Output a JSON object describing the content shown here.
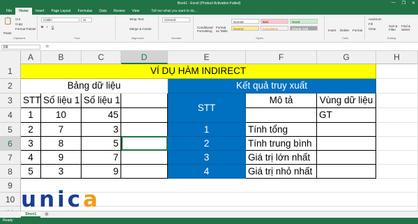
{
  "window": {
    "title": "Book1 - Excel (Product Activation Failed)",
    "controls": [
      "—",
      "❐",
      "✕"
    ]
  },
  "ribbon_tabs": [
    "File",
    "Home",
    "Insert",
    "Page Layout",
    "Formulas",
    "Data",
    "Review",
    "View"
  ],
  "tell_me": "Tell me what you want to do...",
  "ribbon": {
    "clipboard": {
      "label": "Clipboard",
      "paste": "Paste",
      "cut": "Cut",
      "copy": "Copy",
      "painter": "Format Painter"
    },
    "font": {
      "label": "Font",
      "name": "Calibri",
      "size": "11"
    },
    "alignment": {
      "label": "Alignment",
      "wrap": "Wrap Text",
      "merge": "Merge & Center"
    },
    "number": {
      "label": "Number",
      "format": "General"
    },
    "styles": {
      "label": "Styles",
      "conditional": "Conditional Formatting",
      "table": "Format as Table",
      "normal": "Normal",
      "bad": "Bad",
      "good": "Good",
      "neutral": "Neutral",
      "calculation": "Calculation",
      "check": "Check Cell"
    },
    "cells": {
      "label": "Cells",
      "insert": "Insert",
      "delete": "Delete",
      "format": "Format"
    },
    "editing": {
      "label": "Editing",
      "autosum": "AutoSum",
      "fill": "Fill",
      "clear": "Clear",
      "sort": "Sort & Filter",
      "find": "Find & Select"
    }
  },
  "namebox": "D6",
  "fx": "fx",
  "columns": [
    "A",
    "B",
    "C",
    "D",
    "E",
    "F",
    "G",
    "H"
  ],
  "rows": [
    "1",
    "2",
    "3",
    "4",
    "5",
    "6",
    "7",
    "8",
    "9",
    "10",
    "11"
  ],
  "cells": {
    "title": "VÍ DỤ HÀM INDIRECT",
    "bang": "Bảng dữ liệu",
    "ketqua": "Kết quả truy xuất",
    "stt_a3": "STT",
    "so_b3": "Số liệu 1",
    "so_c3": "Số liệu 1",
    "stt_e": "STT",
    "mota": "Mô tả",
    "vung": "Vùng dữ liệu",
    "a4": "1",
    "b4": "10",
    "c4": "45",
    "g4": "GT",
    "a5": "2",
    "b5": "7",
    "c5": "3",
    "e5": "1",
    "f5": "Tính tổng",
    "a6": "3",
    "b6": "8",
    "c6": "5",
    "e6": "2",
    "f6": "Tính trung bình",
    "a7": "4",
    "b7": "9",
    "c7": "7",
    "e7": "3",
    "f7": "Giá trị lớn nhất",
    "a8": "5",
    "b8": "3",
    "c8": "9",
    "e8": "4",
    "f8": "Giá trị nhỏ nhất"
  },
  "watermark": {
    "u": "u",
    "n": "n",
    "i": "i",
    "c": "c",
    "a": "a"
  },
  "sheet_tab": "Sheet1",
  "status": "Ready"
}
